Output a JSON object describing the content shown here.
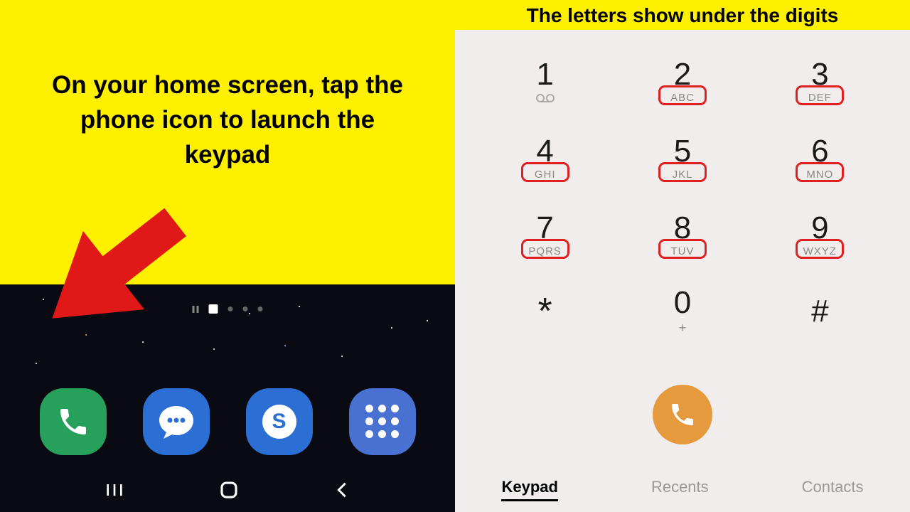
{
  "left": {
    "instruction": "On your home screen, tap the phone icon to launch the keypad"
  },
  "right": {
    "heading": "The letters show under the digits"
  },
  "homescreen": {
    "dock": [
      {
        "name": "phone"
      },
      {
        "name": "messages"
      },
      {
        "name": "skype"
      },
      {
        "name": "apps"
      }
    ]
  },
  "keypad": {
    "keys": [
      {
        "digit": "1",
        "letters": "",
        "voicemail": true,
        "highlight": false
      },
      {
        "digit": "2",
        "letters": "ABC",
        "highlight": true
      },
      {
        "digit": "3",
        "letters": "DEF",
        "highlight": true
      },
      {
        "digit": "4",
        "letters": "GHI",
        "highlight": true
      },
      {
        "digit": "5",
        "letters": "JKL",
        "highlight": true
      },
      {
        "digit": "6",
        "letters": "MNO",
        "highlight": true
      },
      {
        "digit": "7",
        "letters": "PQRS",
        "highlight": true
      },
      {
        "digit": "8",
        "letters": "TUV",
        "highlight": true
      },
      {
        "digit": "9",
        "letters": "WXYZ",
        "highlight": true
      },
      {
        "digit": "*",
        "letters": "",
        "highlight": false,
        "star": true
      },
      {
        "digit": "0",
        "letters": "",
        "plus": "+",
        "highlight": false
      },
      {
        "digit": "#",
        "letters": "",
        "highlight": false
      }
    ]
  },
  "tabs": {
    "keypad": "Keypad",
    "recents": "Recents",
    "contacts": "Contacts"
  }
}
